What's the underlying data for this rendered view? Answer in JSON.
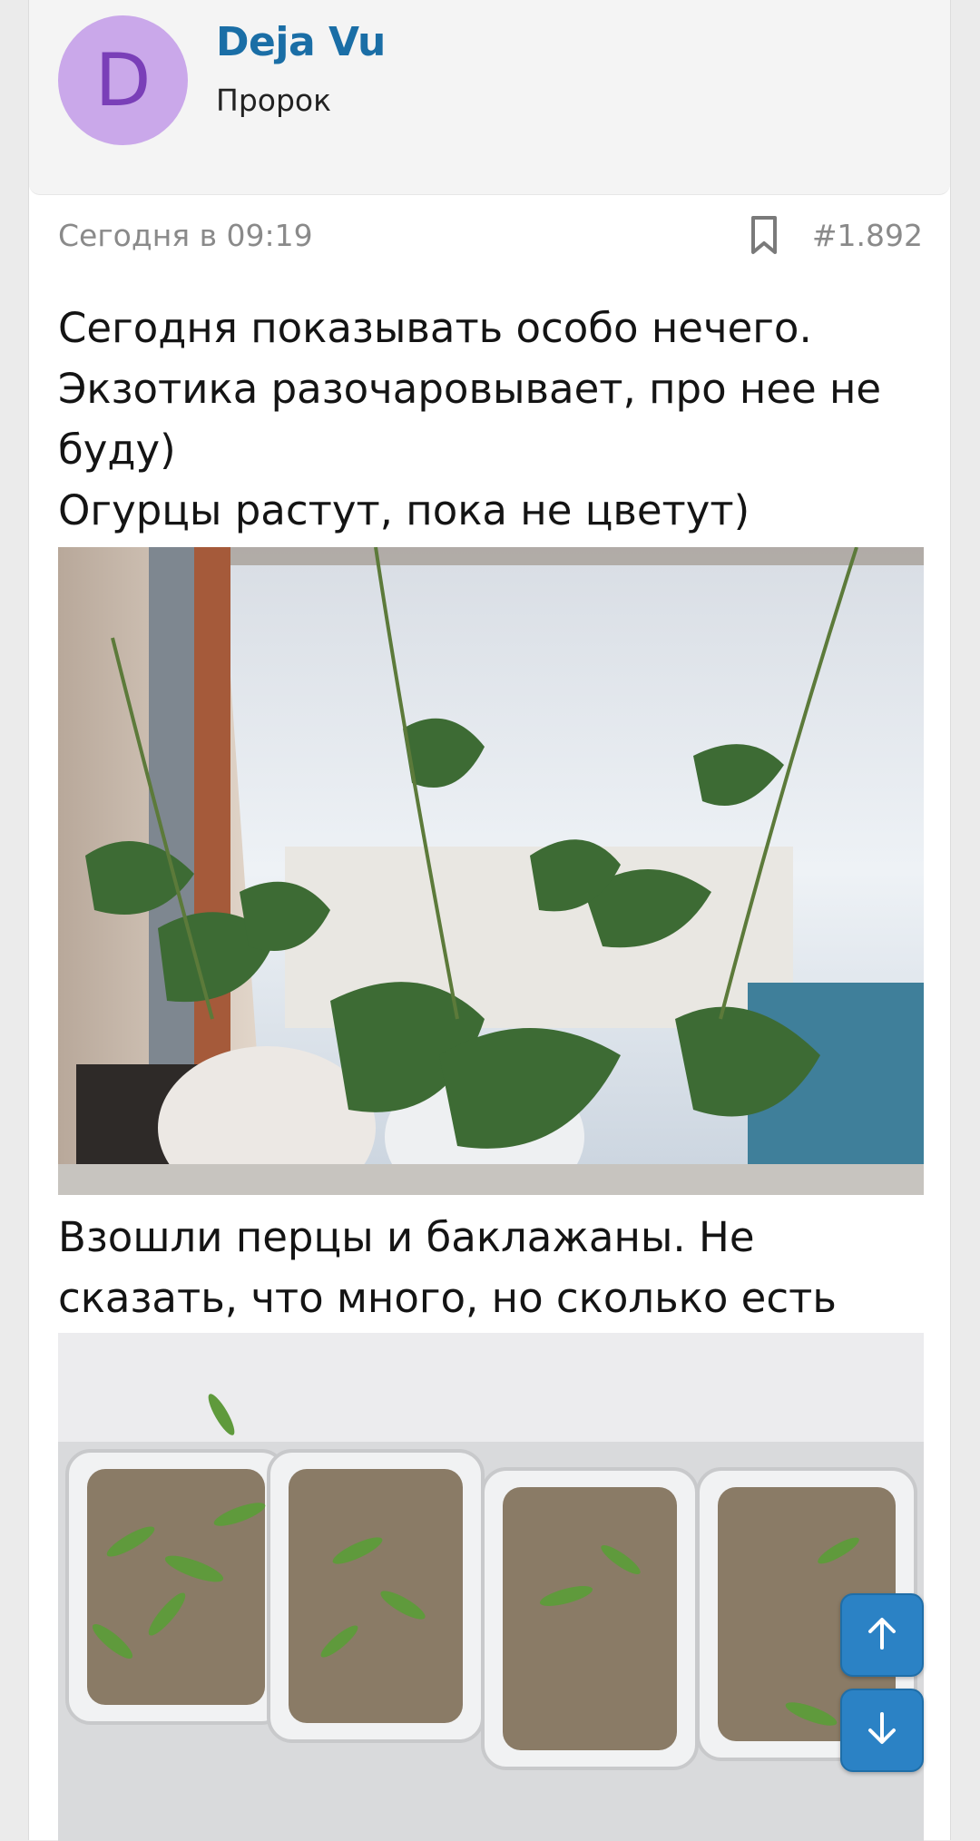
{
  "author": {
    "avatar_letter": "D",
    "name": "Deja Vu",
    "title": "Пророк",
    "avatar_color": "#caa8ea"
  },
  "post": {
    "date": "Сегодня в 09:19",
    "number": "#1.892",
    "paragraph_1": "Сегодня показывать особо нечего.\nЭкзотика разочаровывает, про нее не буду)\nОгурцы растут, пока не цветут)",
    "paragraph_2": "Взошли перцы и баклажаны. Не сказать, что много, но сколько есть"
  },
  "icons": {
    "bookmark": "bookmark-icon",
    "scroll_up": "arrow-up-icon",
    "scroll_down": "arrow-down-icon"
  },
  "colors": {
    "link": "#1a6ea6",
    "fab": "#2b82c5"
  }
}
